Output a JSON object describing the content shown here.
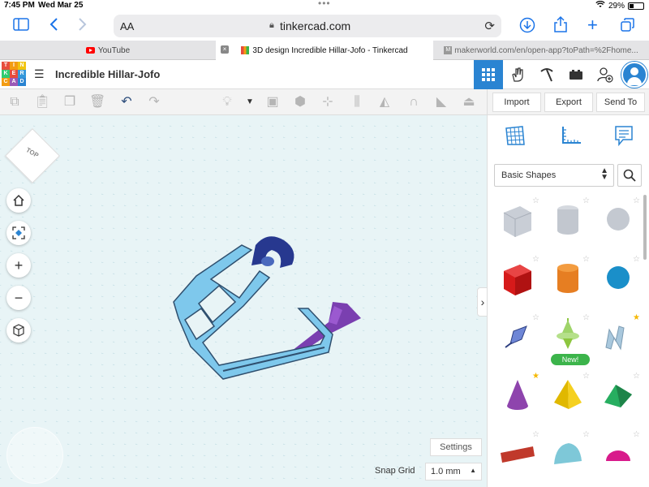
{
  "status_bar": {
    "time": "7:45 PM",
    "date": "Wed Mar 25",
    "battery": "29%"
  },
  "browser": {
    "address_aa": "AA",
    "url": "tinkercad.com",
    "tabs": [
      {
        "label": "YouTube"
      },
      {
        "label": "3D design Incredible Hillar-Jofo - Tinkercad"
      },
      {
        "label": "makerworld.com/en/open-app?toPath=%2Fhome..."
      }
    ]
  },
  "tinkercad": {
    "logo_letters": [
      "T",
      "I",
      "N",
      "K",
      "E",
      "R",
      "C",
      "A",
      "D"
    ],
    "design_title": "Incredible Hillar-Jofo",
    "actions": {
      "import": "Import",
      "export": "Export",
      "send_to": "Send To"
    },
    "shape_library": "Basic Shapes",
    "new_badge": "New!",
    "view_cube": "TOP",
    "settings": "Settings",
    "snap_grid_label": "Snap Grid",
    "snap_grid_value": "1.0 mm"
  }
}
